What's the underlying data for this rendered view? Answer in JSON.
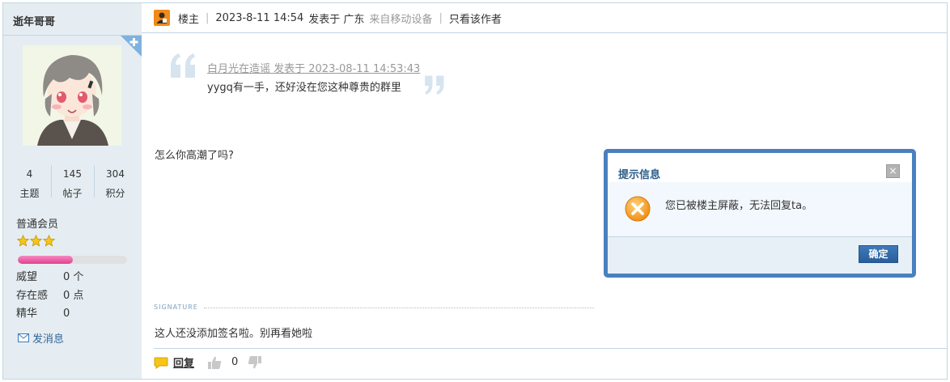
{
  "user": {
    "name": "逝年哥哥",
    "stats": [
      {
        "value": "4",
        "label": "主题"
      },
      {
        "value": "145",
        "label": "帖子"
      },
      {
        "value": "304",
        "label": "积分"
      }
    ],
    "rank": "普通会员",
    "star_count": 3,
    "level_progress": 0.5,
    "fields": [
      {
        "key": "威望",
        "value": "0 个"
      },
      {
        "key": "存在感",
        "value": "0 点"
      },
      {
        "key": "精华",
        "value": "0"
      }
    ],
    "send_message": "发消息"
  },
  "post": {
    "role": "楼主",
    "time": "2023-8-11 14:54",
    "posted_at": "发表于 广东",
    "device": "来自移动设备",
    "only_author": "只看该作者",
    "quote_meta": "白月光在造谣 发表于 2023-08-11 14:53:43",
    "quote_text": "yygq有一手，还好没在您这种尊贵的群里",
    "reply_text": "怎么你高潮了吗?",
    "signature_label": "SIGNATURE",
    "signature_text": "这人还没添加签名啦。别再看她啦",
    "reply_label": "回复",
    "like_count": "0"
  },
  "dialog": {
    "title": "提示信息",
    "message": "您已被楼主屏蔽，无法回复ta。",
    "ok_label": "确定",
    "close_label": "×"
  },
  "colors": {
    "accent": "#4a80bf",
    "sidebar_bg": "#e5edf2",
    "border": "#c2d5e3"
  }
}
